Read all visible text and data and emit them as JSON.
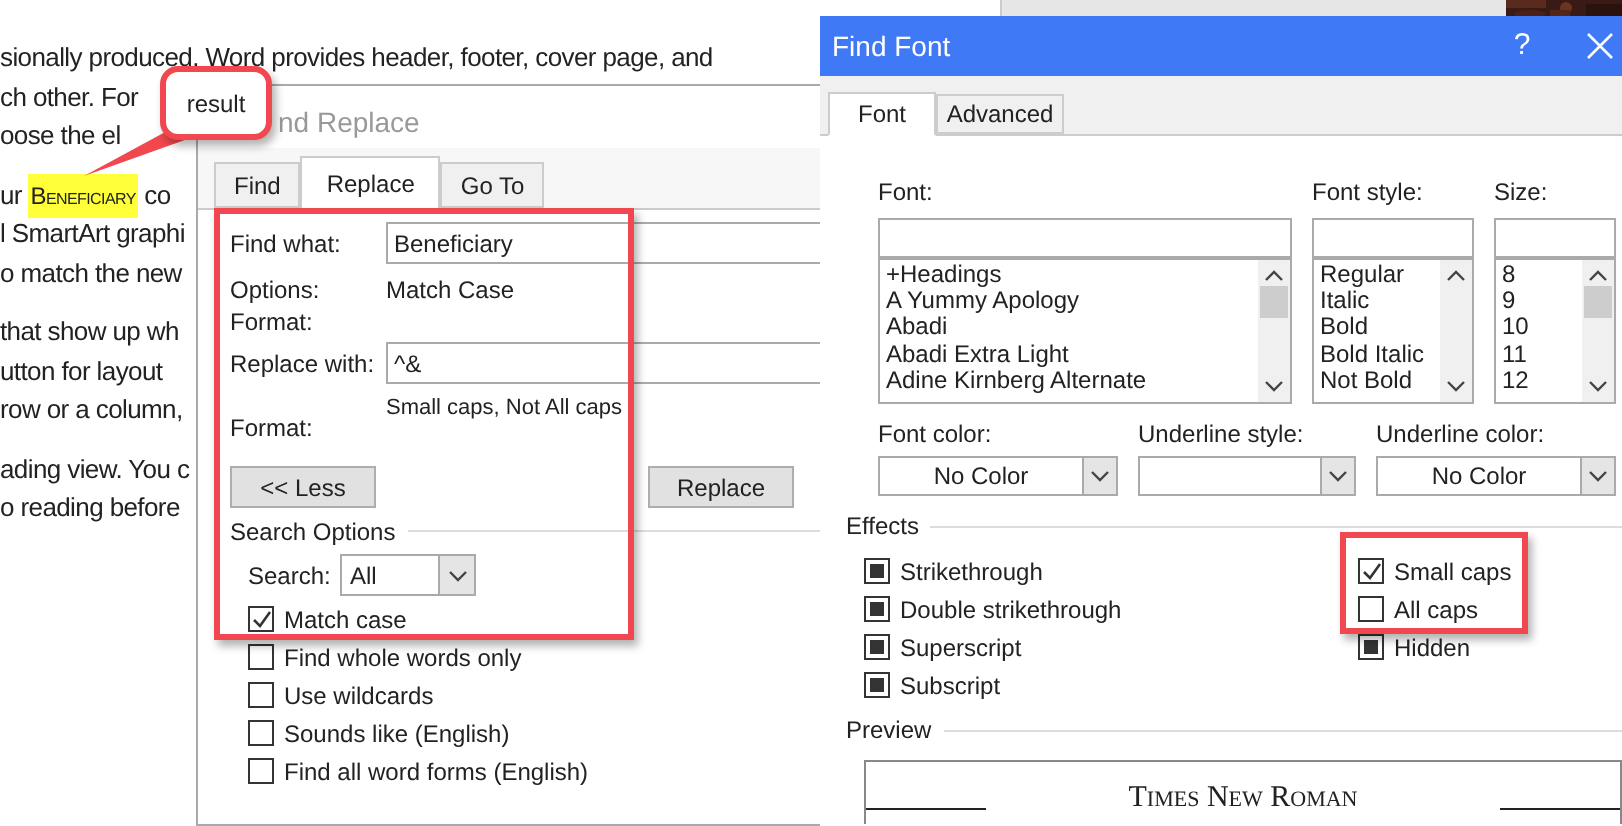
{
  "document": {
    "paragraphs": [
      [
        "sionally produced. Word provides header, footer, cover page, and",
        "ch other. For",
        "oose the el"
      ],
      [
        {
          "before": "ur ",
          "highlight": "Beneficiary",
          "after": " co"
        },
        "l SmartArt graphi",
        "o match the new"
      ],
      [
        "that show up wh",
        "utton for layout",
        "row or a column,"
      ],
      [
        "ading view. You c",
        "o reading before"
      ]
    ]
  },
  "callout": {
    "text": "result"
  },
  "find_replace": {
    "title": "nd Replace",
    "tabs": [
      {
        "label": "Find",
        "selected": false
      },
      {
        "label": "Replace",
        "selected": true
      },
      {
        "label": "Go To",
        "selected": false
      }
    ],
    "find_what": {
      "label": "Find what:",
      "value": "Beneficiary"
    },
    "options": {
      "label": "Options:",
      "value": "Match Case"
    },
    "find_format": {
      "label": "Format:"
    },
    "replace_with": {
      "label": "Replace with:",
      "value": "^&"
    },
    "replace_format": {
      "label": "Format:",
      "value": "Small caps, Not All caps"
    },
    "buttons": [
      "<< Less",
      "Replace"
    ],
    "search_options": {
      "title": "Search Options",
      "search": {
        "label": "Search:",
        "value": "All"
      },
      "checkboxes": [
        {
          "label": "Match case",
          "checked": true
        },
        {
          "label": "Find whole words only",
          "checked": false
        },
        {
          "label": "Use wildcards",
          "checked": false
        },
        {
          "label": "Sounds like (English)",
          "checked": false
        },
        {
          "label": "Find all word forms (English)",
          "checked": false
        }
      ]
    }
  },
  "find_font": {
    "title": "Find Font",
    "help": "?",
    "tabs": [
      {
        "label": "Font",
        "selected": true
      },
      {
        "label": "Advanced",
        "selected": false
      }
    ],
    "lists": [
      {
        "label": "Font:",
        "items": [
          "+Headings",
          "A Yummy Apology",
          "Abadi",
          "Abadi Extra Light",
          "Adine Kirnberg Alternate"
        ]
      },
      {
        "label": "Font style:",
        "items": [
          "Regular",
          "Italic",
          "Bold",
          "Bold Italic",
          "Not Bold"
        ]
      },
      {
        "label": "Size:",
        "items": [
          "8",
          "9",
          "10",
          "11",
          "12"
        ]
      }
    ],
    "dropdowns": [
      {
        "label": "Font color:",
        "value": "No Color"
      },
      {
        "label": "Underline style:"
      },
      {
        "label": "Underline color:",
        "value": "No Color"
      }
    ],
    "effects": {
      "title": "Effects",
      "left": [
        {
          "label": "Strikethrough",
          "checked": false,
          "indeterminate": true
        },
        {
          "label": "Double strikethrough",
          "checked": false,
          "indeterminate": true
        },
        {
          "label": "Superscript",
          "checked": false,
          "indeterminate": true
        },
        {
          "label": "Subscript",
          "checked": false,
          "indeterminate": true
        }
      ],
      "right": [
        {
          "label": "Small caps",
          "checked": true,
          "indeterminate": false
        },
        {
          "label": "All caps",
          "checked": false,
          "indeterminate": false
        },
        {
          "label": "Hidden",
          "checked": false,
          "indeterminate": true
        }
      ]
    },
    "preview": {
      "title": "Preview",
      "sample": "Times New Roman"
    }
  }
}
